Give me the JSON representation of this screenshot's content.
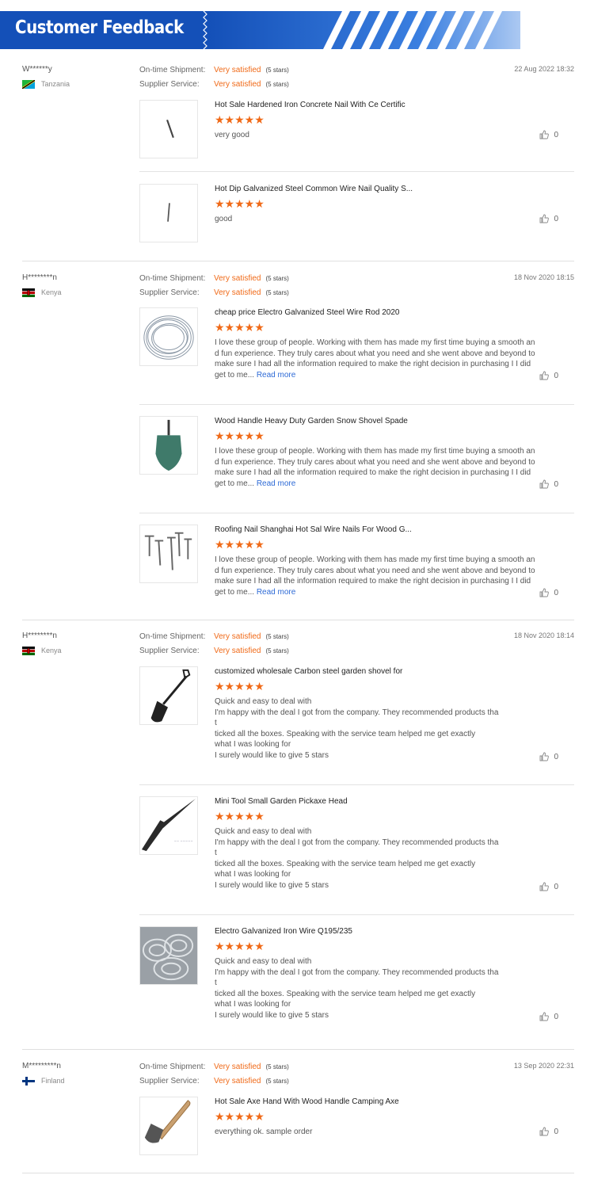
{
  "header": {
    "title": "Customer Feedback",
    "brand_color": "#1450b8"
  },
  "labels": {
    "shipment": "On-time Shipment:",
    "service": "Supplier Service:",
    "read_more": "Read more",
    "stars_suffix": "(5 stars)"
  },
  "reviews": [
    {
      "name": "W******y",
      "country": "Tanzania",
      "date": "22 Aug 2022 18:32",
      "shipment": "Very satisfied",
      "service": "Very satisfied",
      "items": [
        {
          "title": "Hot Sale Hardened Iron Concrete Nail With Ce Certific",
          "stars": "★★★★★",
          "text": "very good",
          "likes": "0"
        },
        {
          "title": "Hot Dip Galvanized Steel Common Wire Nail Quality S...",
          "stars": "★★★★★",
          "text": "good",
          "likes": "0"
        }
      ]
    },
    {
      "name": "H********n",
      "country": "Kenya",
      "date": "18 Nov 2020 18:15",
      "shipment": "Very satisfied",
      "service": "Very satisfied",
      "items": [
        {
          "title": "cheap price Electro Galvanized Steel Wire Rod 2020",
          "stars": "★★★★★",
          "text": "I love these group of people. Working with them has made my first time buying a smooth an\nd fun experience. They truly cares about what you need and she went above and beyond to\nmake sure I had all the information required to make the right decision in purchasing I I did\nget to me...",
          "likes": "0"
        },
        {
          "title": "Wood Handle Heavy Duty Garden Snow Shovel Spade",
          "stars": "★★★★★",
          "text": "I love these group of people. Working with them has made my first time buying a smooth an\nd fun experience. They truly cares about what you need and she went above and beyond to\nmake sure I had all the information required to make the right decision in purchasing I I did\nget to me...",
          "likes": "0"
        },
        {
          "title": "Roofing Nail Shanghai Hot Sal Wire Nails For Wood G...",
          "stars": "★★★★★",
          "text": "I love these group of people. Working with them has made my first time buying a smooth an\nd fun experience. They truly cares about what you need and she went above and beyond to\nmake sure I had all the information required to make the right decision in purchasing I I did\nget to me...",
          "likes": "0"
        }
      ]
    },
    {
      "name": "H********n",
      "country": "Kenya",
      "date": "18 Nov 2020 18:14",
      "shipment": "Very satisfied",
      "service": "Very satisfied",
      "items": [
        {
          "title": "customized wholesale Carbon steel garden shovel for",
          "stars": "★★★★★",
          "text": "Quick and easy to deal with\nI'm happy with the deal I got from the company. They recommended products tha\nt\nticked all the boxes. Speaking with the service team helped me get exactly\nwhat I was looking for\nI surely would like to give 5 stars",
          "likes": "0"
        },
        {
          "title": "Mini Tool Small Garden Pickaxe Head",
          "stars": "★★★★★",
          "text": "Quick and easy to deal with\nI'm happy with the deal I got from the company. They recommended products tha\nt\nticked all the boxes. Speaking with the service team helped me get exactly\nwhat I was looking for\nI surely would like to give 5 stars",
          "likes": "0"
        },
        {
          "title": "Electro Galvanized Iron Wire Q195/235",
          "stars": "★★★★★",
          "text": "Quick and easy to deal with\nI'm happy with the deal I got from the company. They recommended products tha\nt\nticked all the boxes. Speaking with the service team helped me get exactly\nwhat I was looking for\nI surely would like to give 5 stars",
          "likes": "0"
        }
      ]
    },
    {
      "name": "M*********n",
      "country": "Finland",
      "date": "13 Sep 2020 22:31",
      "shipment": "Very satisfied",
      "service": "Very satisfied",
      "items": [
        {
          "title": "Hot Sale Axe Hand With Wood Handle Camping Axe",
          "stars": "★★★★★",
          "text": "everything ok. sample order",
          "likes": "0"
        }
      ]
    }
  ]
}
